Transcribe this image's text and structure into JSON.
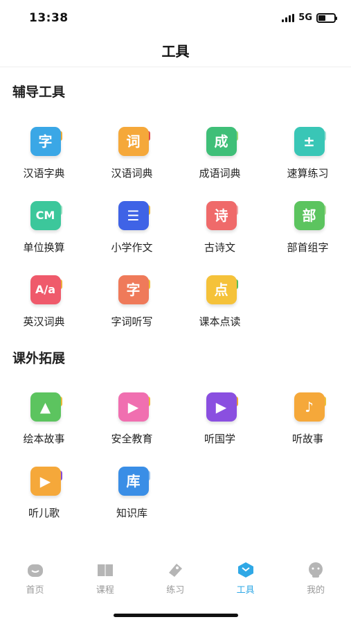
{
  "status": {
    "time": "13:38",
    "network": "5G",
    "battery_level": 0.45
  },
  "header": {
    "title": "工具"
  },
  "sections": [
    {
      "title": "辅导工具",
      "tools": [
        {
          "label": "汉语字典",
          "icon": "zi-icon",
          "glyph": "字",
          "color": "#3aa7e6",
          "tab": "#f5b23d"
        },
        {
          "label": "汉语词典",
          "icon": "ci-icon",
          "glyph": "词",
          "color": "#f5a83a",
          "tab": "#e94e4e"
        },
        {
          "label": "成语词典",
          "icon": "cheng-icon",
          "glyph": "成",
          "color": "#3fbf78",
          "tab": "#a6e07a"
        },
        {
          "label": "速算练习",
          "icon": "calculator-icon",
          "glyph": "±",
          "color": "#39c6b6",
          "tab": "#a6e8de"
        },
        {
          "label": "单位换算",
          "icon": "cm-icon",
          "glyph": "CM",
          "color": "#3cc79b",
          "tab": "#9be6c7"
        },
        {
          "label": "小学作文",
          "icon": "notebook-pencil-icon",
          "glyph": "☰",
          "color": "#3f63e6",
          "tab": "#f5c03a"
        },
        {
          "label": "古诗文",
          "icon": "poem-icon",
          "glyph": "诗",
          "color": "#ef6a6a",
          "tab": "#f7b0b0"
        },
        {
          "label": "部首组字",
          "icon": "radical-icon",
          "glyph": "部",
          "color": "#5cc45f",
          "tab": "#b8e6a3"
        },
        {
          "label": "英汉词典",
          "icon": "english-dictionary-icon",
          "glyph": "A/a",
          "color": "#ef5a6b",
          "tab": "#f7b23d"
        },
        {
          "label": "字词听写",
          "icon": "dictation-icon",
          "glyph": "字",
          "color": "#ef7a5a",
          "tab": "#f5c83a"
        },
        {
          "label": "课本点读",
          "icon": "textbook-reading-icon",
          "glyph": "点",
          "color": "#f5c23a",
          "tab": "#5cc45f"
        }
      ]
    },
    {
      "title": "课外拓展",
      "tools": [
        {
          "label": "绘本故事",
          "icon": "picture-book-icon",
          "glyph": "▲",
          "color": "#5cc45f",
          "tab": "#f5c03a"
        },
        {
          "label": "安全教育",
          "icon": "tv-icon",
          "glyph": "▶",
          "color": "#f06fb0",
          "tab": "#f5c03a"
        },
        {
          "label": "听国学",
          "icon": "video-play-icon",
          "glyph": "▶",
          "color": "#8a4fe0",
          "tab": "#f5a83a"
        },
        {
          "label": "听故事",
          "icon": "music-note-icon",
          "glyph": "♪",
          "color": "#f5a83a",
          "tab": "#f5c83a"
        },
        {
          "label": "听儿歌",
          "icon": "children-song-icon",
          "glyph": "▶",
          "color": "#f5a83a",
          "tab": "#8a4fe0"
        },
        {
          "label": "知识库",
          "icon": "knowledge-base-icon",
          "glyph": "库",
          "color": "#3a8ee6",
          "tab": "#9cc8f5"
        }
      ]
    }
  ],
  "bottom_tabs": [
    {
      "label": "首页",
      "icon": "home-icon",
      "active": false
    },
    {
      "label": "课程",
      "icon": "course-book-icon",
      "active": false
    },
    {
      "label": "练习",
      "icon": "practice-tag-icon",
      "active": false
    },
    {
      "label": "工具",
      "icon": "tools-box-icon",
      "active": true
    },
    {
      "label": "我的",
      "icon": "profile-icon",
      "active": false
    }
  ],
  "colors": {
    "active_tab": "#2fa8e6",
    "inactive_tab": "#999999"
  }
}
